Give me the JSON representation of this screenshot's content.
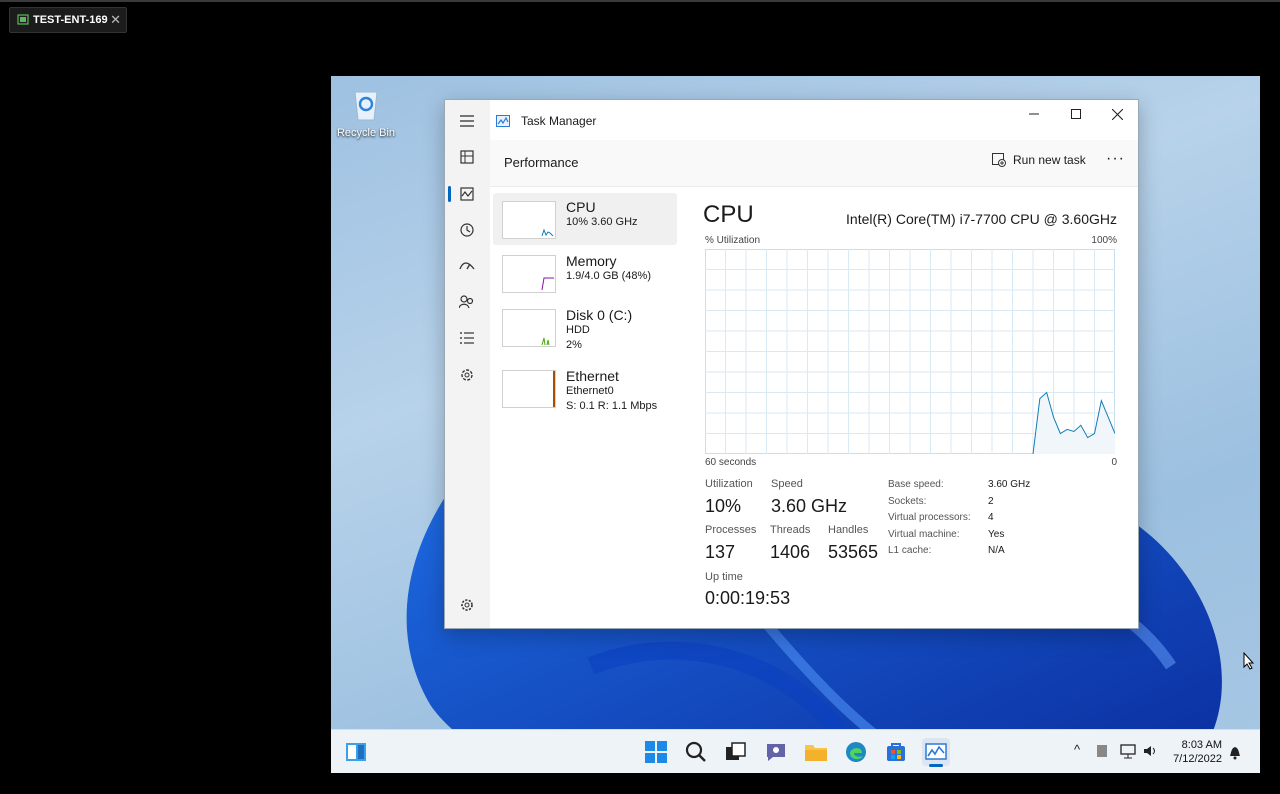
{
  "vm_tab": {
    "title": "TEST-ENT-169",
    "close": "✕"
  },
  "desktop": {
    "recycle_bin_label": "Recycle Bin"
  },
  "window": {
    "title": "Task Manager",
    "minimize": "—",
    "maximize": "☐",
    "close": "✕"
  },
  "header": {
    "title": "Performance",
    "run_new_task": "Run new task",
    "more": "···"
  },
  "devices": [
    {
      "name": "CPU",
      "line1": "10% 3.60 GHz",
      "line2": "",
      "line3": "",
      "color": "#117dbb"
    },
    {
      "name": "Memory",
      "line1": "1.9/4.0 GB (48%)",
      "line2": "",
      "line3": "",
      "color": "#8b12ae"
    },
    {
      "name": "Disk 0 (C:)",
      "line1": "HDD",
      "line2": "2%",
      "line3": "",
      "color": "#4da60c"
    },
    {
      "name": "Ethernet",
      "line1": "Ethernet0",
      "line2": "S: 0.1 R: 1.1 Mbps",
      "line3": "",
      "color": "#a74f01"
    }
  ],
  "cpu": {
    "title": "CPU",
    "model": "Intel(R) Core(TM) i7-7700 CPU @ 3.60GHz",
    "util_label": "% Utilization",
    "util_max": "100%",
    "time_label": "60 seconds",
    "zero_label": "0",
    "stats": {
      "utilization_label": "Utilization",
      "utilization": "10%",
      "speed_label": "Speed",
      "speed": "3.60 GHz",
      "processes_label": "Processes",
      "processes": "137",
      "threads_label": "Threads",
      "threads": "1406",
      "handles_label": "Handles",
      "handles": "53565",
      "uptime_label": "Up time",
      "uptime": "0:00:19:53"
    },
    "details": [
      {
        "key": "Base speed:",
        "value": "3.60 GHz"
      },
      {
        "key": "Sockets:",
        "value": "2"
      },
      {
        "key": "Virtual processors:",
        "value": "4"
      },
      {
        "key": "Virtual machine:",
        "value": "Yes"
      },
      {
        "key": "L1 cache:",
        "value": "N/A"
      }
    ]
  },
  "chart_data": {
    "type": "area",
    "title": "",
    "xlabel": "60 seconds",
    "ylabel": "% Utilization",
    "ylim": [
      0,
      100
    ],
    "xlim": [
      60,
      0
    ],
    "grid": true,
    "series": [
      {
        "x": [
          12,
          11,
          10,
          9,
          8,
          7,
          6,
          5,
          4,
          3,
          2,
          1,
          0
        ],
        "values": [
          0,
          27,
          30,
          18,
          10,
          12,
          11,
          14,
          8,
          10,
          26,
          18,
          10
        ]
      }
    ]
  },
  "taskbar": {
    "time": "8:03 AM",
    "date": "7/12/2022",
    "chevron": "^"
  },
  "colors": {
    "accent": "#0067c0",
    "cpu_line": "#117dbb",
    "grid": "#d9eaf4"
  }
}
